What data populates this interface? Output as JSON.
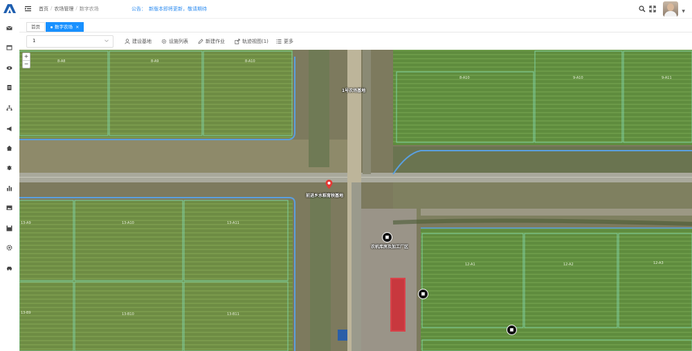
{
  "sidebar": {
    "icons": [
      "mail-icon",
      "calendar-icon",
      "eye-icon",
      "clipboard-icon",
      "tree-icon",
      "megaphone-icon",
      "home-icon",
      "bug-icon",
      "bar-chart-icon",
      "image-icon",
      "save-icon",
      "gear-icon",
      "car-icon"
    ]
  },
  "header": {
    "breadcrumb": [
      "首页",
      "农场管理",
      "数字农场"
    ],
    "notice_label": "公告：",
    "notice_text": "新版本即将更新，敬请期待"
  },
  "tabs": {
    "home": "首页",
    "active": "数字农场"
  },
  "toolbar": {
    "select_value": "1",
    "buttons": [
      "建设基地",
      "设施列表",
      "新建作业",
      "轨迹视图(1)",
      "更多"
    ]
  },
  "map": {
    "field_labels": [
      "8-A8",
      "8-A9",
      "8-A10",
      "8-A10",
      "9-A10",
      "9-A11",
      "13-A9",
      "13-A10",
      "13-A11",
      "12-A1",
      "12-A2",
      "12-A3",
      "13-B9",
      "13-B10",
      "13-B11"
    ],
    "place_labels": {
      "station": "1号农场基地",
      "farm": "前进乡水稻育秧基地",
      "facility": "农机库房及加工厂区"
    }
  },
  "colors": {
    "accent": "#1890ff",
    "field_border": "#7fd0a0",
    "canal": "#5aa0e0"
  }
}
